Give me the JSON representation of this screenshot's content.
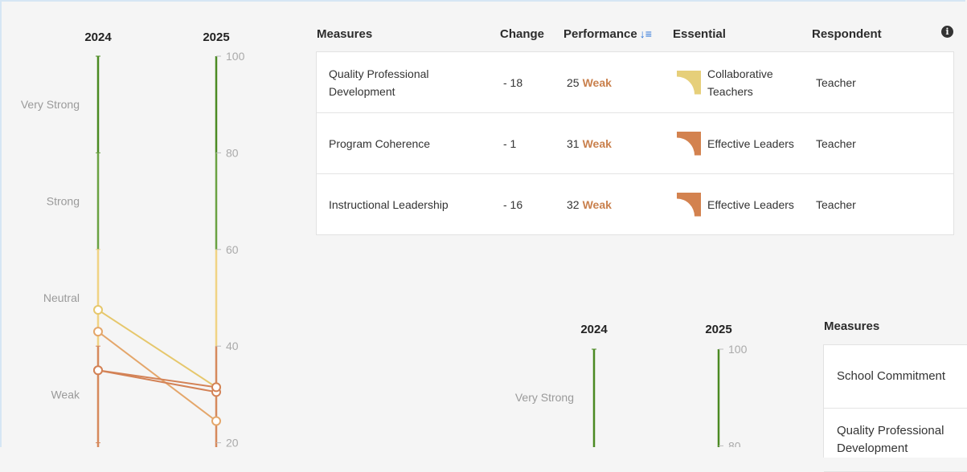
{
  "chart_data": [
    {
      "type": "slope",
      "years": [
        "2024",
        "2025"
      ],
      "bands": [
        "Very Strong",
        "Strong",
        "Neutral",
        "Weak"
      ],
      "ticks": [
        100,
        80,
        60,
        40,
        20
      ],
      "series": [
        {
          "values": [
            47.5,
            31.5
          ],
          "color": "#e6c76c"
        },
        {
          "values": [
            43,
            24.5
          ],
          "color": "#e4a66a"
        },
        {
          "values": [
            35,
            30.5
          ],
          "color": "#d38256"
        },
        {
          "values": [
            35,
            31.5
          ],
          "color": "#d38256"
        }
      ]
    },
    {
      "type": "slope",
      "years": [
        "2024",
        "2025"
      ],
      "bands": [
        "Very Strong"
      ],
      "ticks": [
        100,
        80
      ]
    }
  ],
  "table": {
    "headers": {
      "measures": "Measures",
      "change": "Change",
      "performance": "Performance",
      "essential": "Essential",
      "respondent": "Respondent"
    },
    "rows": [
      {
        "measure": "Quality Professional Development",
        "change": "- 18",
        "score": "25",
        "rating": "Weak",
        "essential": "Collaborative Teachers",
        "essential_color": "#e6cf7a",
        "respondent": "Teacher"
      },
      {
        "measure": "Program Coherence",
        "change": "- 1",
        "score": "31",
        "rating": "Weak",
        "essential": "Effective Leaders",
        "essential_color": "#d3824f",
        "respondent": "Teacher"
      },
      {
        "measure": "Instructional Leadership",
        "change": "- 16",
        "score": "32",
        "rating": "Weak",
        "essential": "Effective Leaders",
        "essential_color": "#d3824f",
        "respondent": "Teacher"
      }
    ]
  },
  "table2": {
    "header": "Measures",
    "rows": [
      "School Commitment",
      "Quality Professional Development"
    ]
  },
  "icons": {
    "sort": "sort-icon",
    "info": "info-icon"
  },
  "colors": {
    "very_strong": "#4b8a22",
    "strong": "#6aa242",
    "neutral": "#f0d384",
    "weak": "#d6895c",
    "weak_rating_text": "#c9804d"
  }
}
